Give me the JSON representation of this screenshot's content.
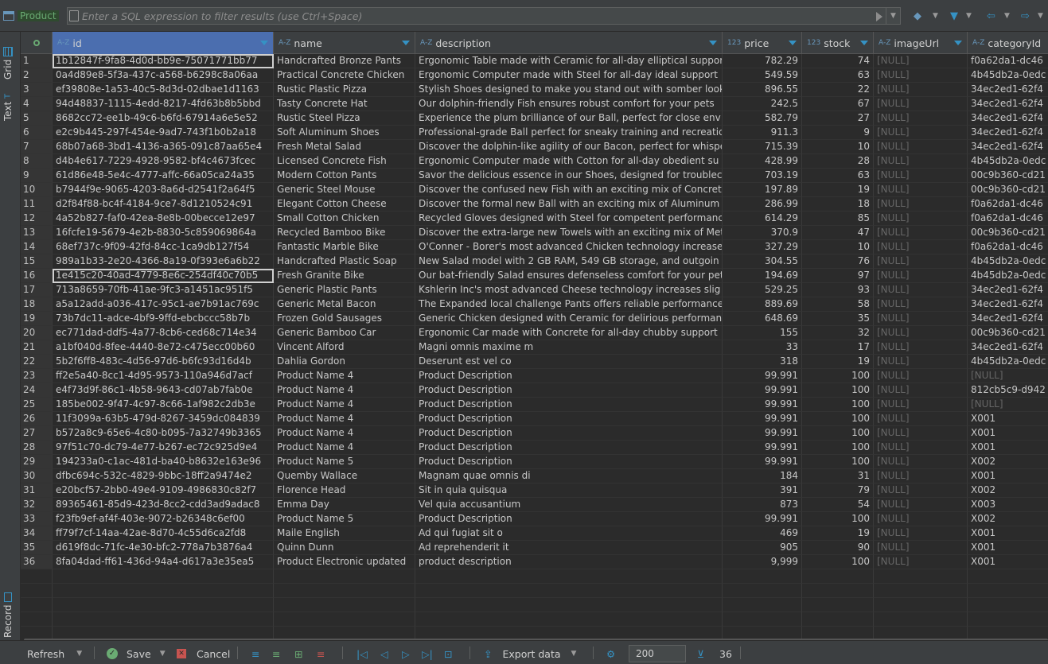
{
  "filter": {
    "tab_name": "Product",
    "placeholder": "Enter a SQL expression to filter results (use Ctrl+Space)"
  },
  "sidebar": {
    "tabs": [
      {
        "label": "Grid",
        "icon": "grid-icon"
      },
      {
        "label": "Text",
        "icon": "text-icon"
      },
      {
        "label": "Record",
        "icon": "record-icon"
      }
    ]
  },
  "columns": [
    {
      "label": "id",
      "type": "A-Z"
    },
    {
      "label": "name",
      "type": "A-Z"
    },
    {
      "label": "description",
      "type": "A-Z"
    },
    {
      "label": "price",
      "type": "123"
    },
    {
      "label": "stock",
      "type": "123"
    },
    {
      "label": "imageUrl",
      "type": "A-Z"
    },
    {
      "label": "categoryId",
      "type": "A-Z"
    }
  ],
  "rows": [
    [
      "1",
      "1b12847f-9fa8-4d0d-bb9e-75071771bb77",
      "Handcrafted Bronze Pants",
      "Ergonomic Table made with Ceramic for all-day elliptical support",
      "782.29",
      "74",
      "[NULL]",
      "f0a62da1-dc46"
    ],
    [
      "2",
      "0a4d89e8-5f3a-437c-a568-b6298c8a06aa",
      "Practical Concrete Chicken",
      "Ergonomic Computer made with Steel for all-day ideal support",
      "549.59",
      "63",
      "[NULL]",
      "4b45db2a-0edc"
    ],
    [
      "3",
      "ef39808e-1a53-40c5-8d3d-02dbae1d1163",
      "Rustic Plastic Pizza",
      "Stylish Shoes designed to make you stand out with somber looks",
      "896.55",
      "22",
      "[NULL]",
      "34ec2ed1-62f4"
    ],
    [
      "4",
      "94d48837-1115-4edd-8217-4fd63b8b5bbd",
      "Tasty Concrete Hat",
      "Our dolphin-friendly Fish ensures robust comfort for your pets",
      "242.5",
      "67",
      "[NULL]",
      "34ec2ed1-62f4"
    ],
    [
      "5",
      "8682cc72-ee1b-49c6-b6fd-67914a6e5e52",
      "Rustic Steel Pizza",
      "Experience the plum brilliance of our Ball, perfect for close env",
      "582.79",
      "27",
      "[NULL]",
      "34ec2ed1-62f4"
    ],
    [
      "6",
      "e2c9b445-297f-454e-9ad7-743f1b0b2a18",
      "Soft Aluminum Shoes",
      "Professional-grade Ball perfect for sneaky training and recreatic",
      "911.3",
      "9",
      "[NULL]",
      "34ec2ed1-62f4"
    ],
    [
      "7",
      "68b07a68-3bd1-4136-a365-091c87aa65e4",
      "Fresh Metal Salad",
      "Discover the dolphin-like agility of our Bacon, perfect for whispe",
      "715.39",
      "10",
      "[NULL]",
      "34ec2ed1-62f4"
    ],
    [
      "8",
      "d4b4e617-7229-4928-9582-bf4c4673fcec",
      "Licensed Concrete Fish",
      "Ergonomic Computer made with Cotton for all-day obedient su",
      "428.99",
      "28",
      "[NULL]",
      "4b45db2a-0edc"
    ],
    [
      "9",
      "61d86e48-5e4c-4777-affc-66a05ca24a35",
      "Modern Cotton Pants",
      "Savor the delicious essence in our Shoes, designed for troublec",
      "703.19",
      "63",
      "[NULL]",
      "00c9b360-cd21"
    ],
    [
      "10",
      "b7944f9e-9065-4203-8a6d-d2541f2a64f5",
      "Generic Steel Mouse",
      "Discover the confused new Fish with an exciting mix of Concret",
      "197.89",
      "19",
      "[NULL]",
      "00c9b360-cd21"
    ],
    [
      "11",
      "d2f84f88-bc4f-4184-9ce7-8d1210524c91",
      "Elegant Cotton Cheese",
      "Discover the formal new Ball with an exciting mix of Aluminum",
      "286.99",
      "18",
      "[NULL]",
      "f0a62da1-dc46"
    ],
    [
      "12",
      "4a52b827-faf0-42ea-8e8b-00becce12e97",
      "Small Cotton Chicken",
      "Recycled Gloves designed with Steel for competent performanc",
      "614.29",
      "85",
      "[NULL]",
      "f0a62da1-dc46"
    ],
    [
      "13",
      "16fcfe19-5679-4e2b-8830-5c859069864a",
      "Recycled Bamboo Bike",
      "Discover the extra-large new Towels with an exciting mix of Met",
      "370.9",
      "47",
      "[NULL]",
      "00c9b360-cd21"
    ],
    [
      "14",
      "68ef737c-9f09-42fd-84cc-1ca9db127f54",
      "Fantastic Marble Bike",
      "O'Conner - Borer's most advanced Chicken technology increase",
      "327.29",
      "10",
      "[NULL]",
      "f0a62da1-dc46"
    ],
    [
      "15",
      "989a1b33-2e20-4366-8a19-0f393e6a6b22",
      "Handcrafted Plastic Soap",
      "New Salad model with 2 GB RAM, 549 GB storage, and outgoin",
      "304.55",
      "76",
      "[NULL]",
      "4b45db2a-0edc"
    ],
    [
      "16",
      "1e415c20-40ad-4779-8e6c-254df40c70b5",
      "Fresh Granite Bike",
      "Our bat-friendly Salad ensures defenseless comfort for your pet",
      "194.69",
      "97",
      "[NULL]",
      "4b45db2a-0edc"
    ],
    [
      "17",
      "713a8659-70fb-41ae-9fc3-a1451ac951f5",
      "Generic Plastic Pants",
      "Kshlerin Inc's most advanced Cheese technology increases slig",
      "529.25",
      "93",
      "[NULL]",
      "34ec2ed1-62f4"
    ],
    [
      "18",
      "a5a12add-a036-417c-95c1-ae7b91ac769c",
      "Generic Metal Bacon",
      "The Expanded local challenge Pants offers reliable performance",
      "889.69",
      "58",
      "[NULL]",
      "34ec2ed1-62f4"
    ],
    [
      "19",
      "73b7dc11-adce-4bf9-9ffd-ebcbccc58b7b",
      "Frozen Gold Sausages",
      "Generic Chicken designed with Ceramic for delirious performan",
      "648.69",
      "35",
      "[NULL]",
      "34ec2ed1-62f4"
    ],
    [
      "20",
      "ec771dad-ddf5-4a77-8cb6-ced68c714e34",
      "Generic Bamboo Car",
      "Ergonomic Car made with Concrete for all-day chubby support",
      "155",
      "32",
      "[NULL]",
      "00c9b360-cd21"
    ],
    [
      "21",
      "a1bf040d-8fee-4440-8e72-c475ecc00b60",
      "Vincent Alford",
      "Magni omnis maxime m",
      "33",
      "17",
      "[NULL]",
      "34ec2ed1-62f4"
    ],
    [
      "22",
      "5b2f6ff8-483c-4d56-97d6-b6fc93d16d4b",
      "Dahlia Gordon",
      "Deserunt est vel co",
      "318",
      "19",
      "[NULL]",
      "4b45db2a-0edc"
    ],
    [
      "23",
      "ff2e5a40-8cc1-4d95-9573-110a946d7acf",
      "Product Name 4",
      "Product Description",
      "99.991",
      "100",
      "[NULL]",
      "[NULL]"
    ],
    [
      "24",
      "e4f73d9f-86c1-4b58-9643-cd07ab7fab0e",
      "Product Name 4",
      "Product Description",
      "99.991",
      "100",
      "[NULL]",
      "812cb5c9-d942"
    ],
    [
      "25",
      "185be002-9f47-4c97-8c66-1af982c2db3e",
      "Product Name 4",
      "Product Description",
      "99.991",
      "100",
      "[NULL]",
      "[NULL]"
    ],
    [
      "26",
      "11f3099a-63b5-479d-8267-3459dc084839",
      "Product Name 4",
      "Product Description",
      "99.991",
      "100",
      "[NULL]",
      "X001"
    ],
    [
      "27",
      "b572a8c9-65e6-4c80-b095-7a32749b3365",
      "Product Name 4",
      "Product Description",
      "99.991",
      "100",
      "[NULL]",
      "X001"
    ],
    [
      "28",
      "97f51c70-dc79-4e77-b267-ec72c925d9e4",
      "Product Name 4",
      "Product Description",
      "99.991",
      "100",
      "[NULL]",
      "X001"
    ],
    [
      "29",
      "194233a0-c1ac-481d-ba40-b8632e163e96",
      "Product Name 5",
      "Product Description",
      "99.991",
      "100",
      "[NULL]",
      "X002"
    ],
    [
      "30",
      "dfbc694c-532c-4829-9bbc-18ff2a9474e2",
      "Quemby Wallace",
      "Magnam quae omnis di",
      "184",
      "31",
      "[NULL]",
      "X001"
    ],
    [
      "31",
      "e20bcf57-2bb0-49e4-9109-4986830c82f7",
      "Florence Head",
      "Sit in quia quisqua",
      "391",
      "79",
      "[NULL]",
      "X002"
    ],
    [
      "32",
      "89365461-85d9-423d-8cc2-cdd3ad9adac8",
      "Emma Day",
      "Vel quia accusantium",
      "873",
      "54",
      "[NULL]",
      "X003"
    ],
    [
      "33",
      "f23fb9ef-af4f-403e-9072-b26348c6ef00",
      "Product Name 5",
      "Product Description",
      "99.991",
      "100",
      "[NULL]",
      "X002"
    ],
    [
      "34",
      "ff79f7cf-14aa-42ae-8d70-4c55d6ca2fd8",
      "Maile English",
      "Ad qui fugiat sit o",
      "469",
      "19",
      "[NULL]",
      "X001"
    ],
    [
      "35",
      "d619f8dc-71fc-4e30-bfc2-778a7b3876a4",
      "Quinn Dunn",
      "Ad reprehenderit it",
      "905",
      "90",
      "[NULL]",
      "X001"
    ],
    [
      "36",
      "8fa04dad-ff61-436d-94a4-d617a3e35ea5",
      "Product Electronic updated",
      "product description",
      "9,999",
      "100",
      "[NULL]",
      "X001"
    ]
  ],
  "bottom": {
    "refresh": "Refresh",
    "save": "Save",
    "cancel": "Cancel",
    "export": "Export data",
    "fetch_size": "200",
    "row_count": "36"
  },
  "colors": {
    "accent": "#4b6eaf",
    "null": "#666666",
    "status_ok": "#6aab73"
  }
}
